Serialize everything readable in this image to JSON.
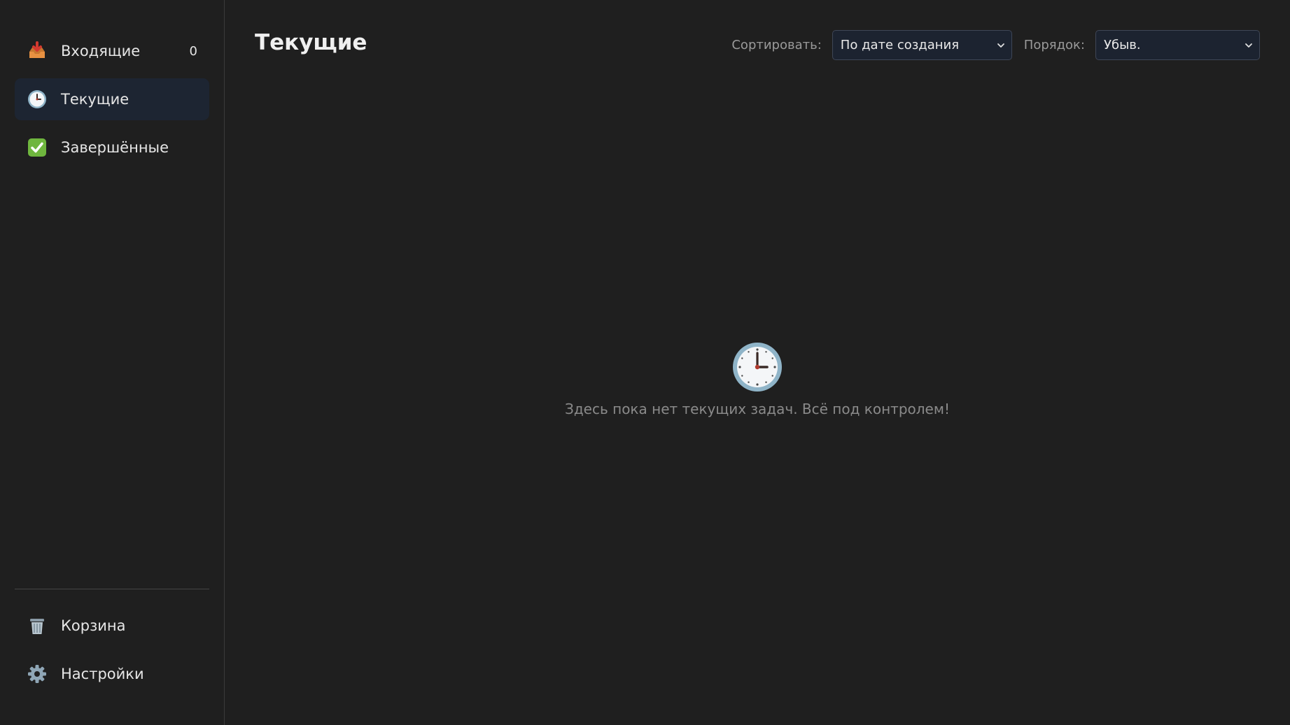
{
  "sidebar": {
    "items": [
      {
        "label": "Входящие",
        "count": "0",
        "icon": "inbox-tray-icon"
      },
      {
        "label": "Текущие",
        "icon": "clock-icon",
        "active": true
      },
      {
        "label": "Завершённые",
        "icon": "check-mark-icon"
      }
    ],
    "bottom_items": [
      {
        "label": "Корзина",
        "icon": "trash-icon"
      },
      {
        "label": "Настройки",
        "icon": "gear-icon"
      }
    ]
  },
  "main": {
    "title": "Текущие",
    "sort_label": "Сортировать:",
    "sort_value": "По дате создания",
    "order_label": "Порядок:",
    "order_value": "Убыв.",
    "empty_state": {
      "icon": "clock-icon",
      "text": "Здесь пока нет текущих задач. Всё под контролем!"
    }
  },
  "colors": {
    "background": "#1f1f1f",
    "active_item": "#1d2532",
    "select_bg": "#1c2330",
    "select_border": "#3e4656",
    "muted_text": "#8a8a8a"
  }
}
